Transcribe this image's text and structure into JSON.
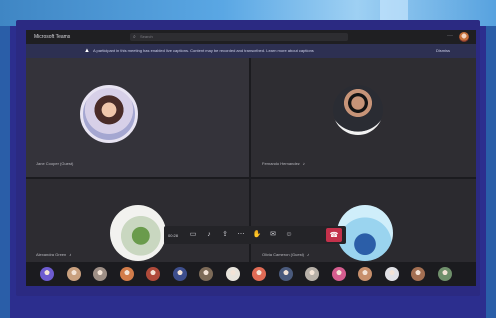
{
  "app": {
    "title": "Microsoft Teams"
  },
  "search": {
    "placeholder": "Search",
    "icon": "search-icon"
  },
  "titlebar": {
    "more_label": "···"
  },
  "banner": {
    "icon": "warning-icon",
    "text": "A participant in this meeting has enabled live captions. Content may be recorded and transcribed. Learn more about captions",
    "dismiss_label": "Dismiss"
  },
  "participants": [
    {
      "name": "Jane Cooper (Guest)",
      "avatar_colors": [
        "#f0c6ab",
        "#4a2c28",
        "#d7d0e8"
      ]
    },
    {
      "name": "Fernando Hernandez",
      "avatar_colors": [
        "#c79478",
        "#2a2c33",
        "#f2f2f2"
      ]
    },
    {
      "name": "Alexandra Green",
      "avatar_colors": [
        "#6a9b4c",
        "#c9d7c0",
        "#f2f2ef"
      ]
    },
    {
      "name": "Olivia Cameron (Guest)",
      "avatar_colors": [
        "#2b5ea8",
        "#9ad4ef",
        "#cfeefa"
      ]
    }
  ],
  "toolbar": {
    "timer": "00:28",
    "buttons": [
      {
        "name": "video-icon",
        "glyph": "▭"
      },
      {
        "name": "mic-icon",
        "glyph": "♪"
      },
      {
        "name": "share-icon",
        "glyph": "⇪"
      },
      {
        "name": "more-icon",
        "glyph": "⋯"
      },
      {
        "name": "hand-icon",
        "glyph": "✋"
      },
      {
        "name": "chat-icon",
        "glyph": "✉"
      },
      {
        "name": "people-icon",
        "glyph": "☺"
      }
    ],
    "hangup_glyph": "☎"
  },
  "thumbnail_colors": [
    "#6d5bd0",
    "#c9a07e",
    "#9e8f86",
    "#d27c4a",
    "#b04a3a",
    "#3d4e8c",
    "#7c6a57",
    "#e8e4dc",
    "#e06b55",
    "#4a5a7c",
    "#b7b0a8",
    "#d55d8f",
    "#c78f6b",
    "#e1e1e6",
    "#a36f52",
    "#6f8f6b"
  ],
  "accent_colors": {
    "hangup": "#c4314b",
    "frame": "#2b2a82"
  }
}
